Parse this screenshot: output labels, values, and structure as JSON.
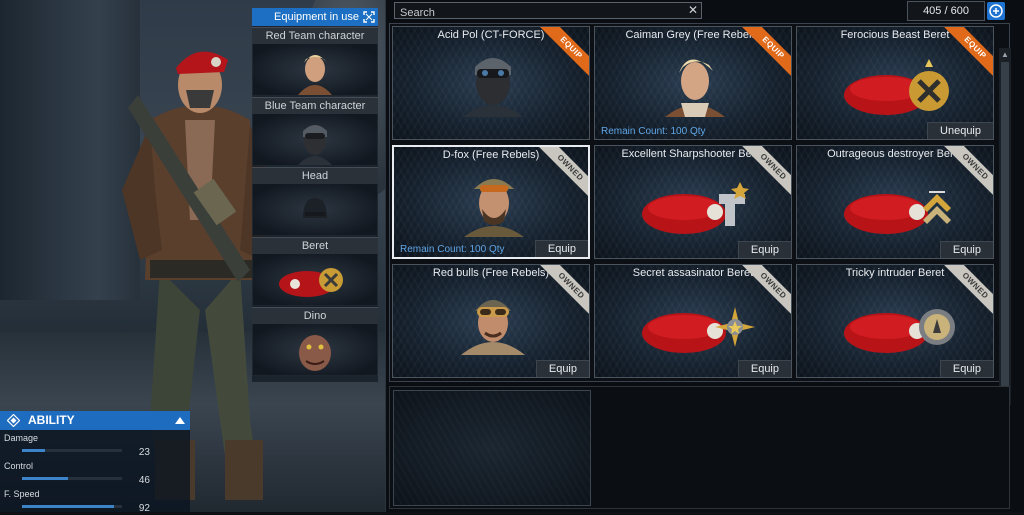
{
  "equipment_in_use": {
    "title": "Equipment in use",
    "slots": [
      {
        "label": "Red Team character"
      },
      {
        "label": "Blue Team character"
      },
      {
        "label": "Head"
      },
      {
        "label": "Beret"
      },
      {
        "label": "Dino"
      }
    ]
  },
  "ability": {
    "title": "ABILITY",
    "stats": [
      {
        "label": "Damage",
        "value": "23",
        "fraction": 0.23
      },
      {
        "label": "Control",
        "value": "46",
        "fraction": 0.46
      },
      {
        "label": "F. Speed",
        "value": "92",
        "fraction": 0.92
      }
    ]
  },
  "inventory": {
    "search_placeholder": "Search",
    "count": "405 / 600",
    "items": [
      {
        "name": "Acid Pol (CT-FORCE)",
        "badge": "EQUIP",
        "kind": "face-mask"
      },
      {
        "name": "Caiman Grey (Free Rebels)",
        "badge": "EQUIP",
        "remain": "Remain Count: 100 Qty",
        "kind": "face-blonde"
      },
      {
        "name": "Ferocious Beast Beret",
        "badge": "EQUIP",
        "button": "Unequip",
        "kind": "beret"
      },
      {
        "name": "D-fox (Free Rebels)",
        "badge": "OWNED",
        "remain": "Remain Count: 100 Qty",
        "button": "Equip",
        "kind": "face-cap"
      },
      {
        "name": "Excellent Sharpshooter Beret",
        "badge": "OWNED",
        "button": "Equip",
        "kind": "beret"
      },
      {
        "name": "Outrageous destroyer Beret",
        "badge": "OWNED",
        "button": "Equip",
        "kind": "beret"
      },
      {
        "name": "Red bulls (Free Rebels)",
        "badge": "OWNED",
        "button": "Equip",
        "kind": "face-goggles"
      },
      {
        "name": "Secret assasinator Beret",
        "badge": "OWNED",
        "button": "Equip",
        "kind": "beret"
      },
      {
        "name": "Tricky intruder Beret",
        "badge": "OWNED",
        "button": "Equip",
        "kind": "beret"
      }
    ]
  },
  "colors": {
    "accent_blue": "#1e6cc0",
    "equip_badge": "#e06a1a",
    "owned_badge": "#c9c6bf",
    "beret_red": "#c0161a"
  }
}
